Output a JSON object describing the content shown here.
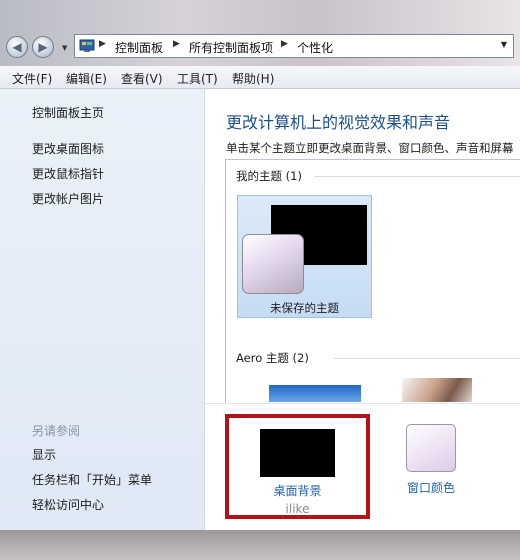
{
  "address_bar": {
    "crumbs": [
      "控制面板",
      "所有控制面板项",
      "个性化"
    ]
  },
  "menu": [
    "文件(F)",
    "编辑(E)",
    "查看(V)",
    "工具(T)",
    "帮助(H)"
  ],
  "left_pane": {
    "home": "控制面板主页",
    "links": [
      "更改桌面图标",
      "更改鼠标指针",
      "更改帐户图片"
    ],
    "see_also_title": "另请参阅",
    "see_also": [
      "显示",
      "任务栏和「开始」菜单",
      "轻松访问中心"
    ]
  },
  "main": {
    "title": "更改计算机上的视觉效果和声音",
    "subtitle": "单击某个主题立即更改桌面背景、窗口颜色、声音和屏幕",
    "my_themes_header": "我的主题 (1)",
    "unsaved_theme": "未保存的主题",
    "aero_header": "Aero 主题 (2)"
  },
  "bottom_options": {
    "desktop_background": "桌面背景",
    "watermark": "ilike",
    "window_color": "窗口颜色"
  },
  "colors": {
    "highlight_border": "#b31217",
    "link_blue": "#1f63b0",
    "title_blue": "#1f4f8a"
  }
}
